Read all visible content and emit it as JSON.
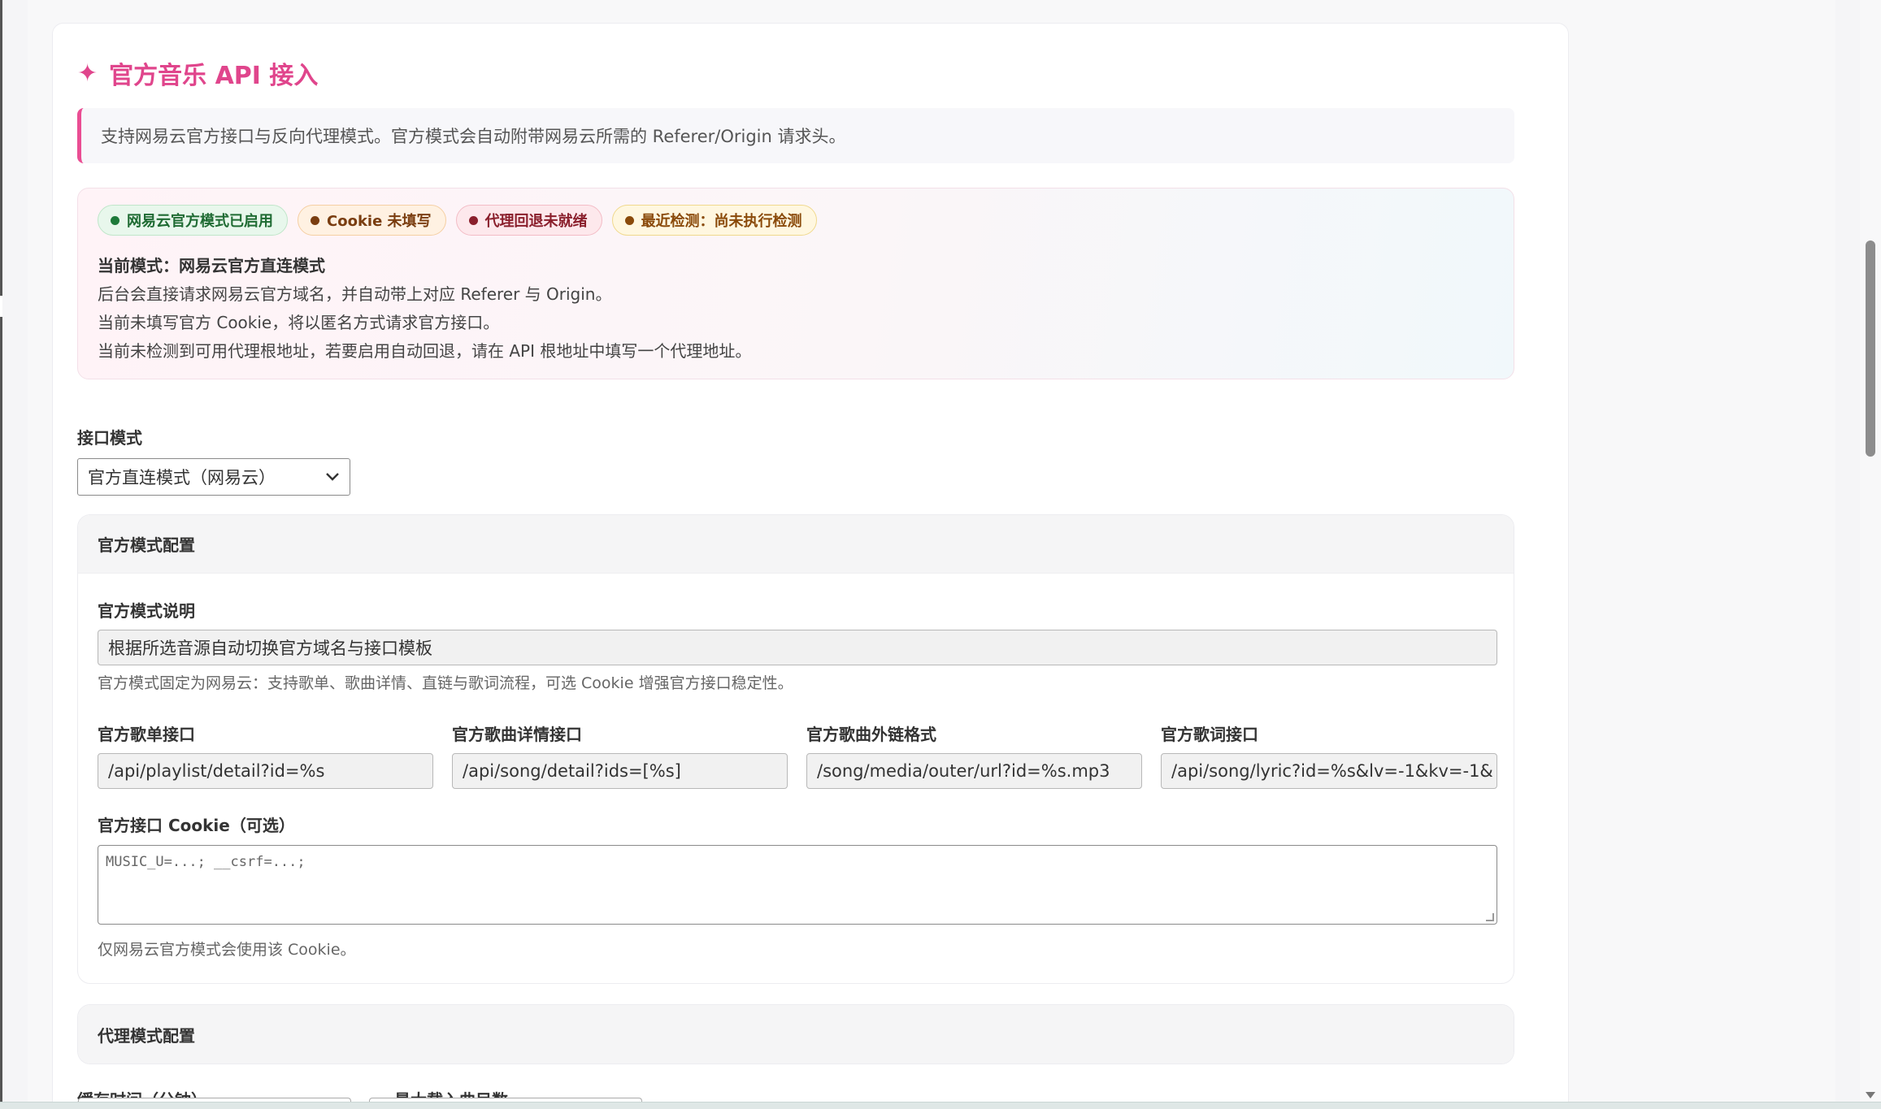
{
  "card": {
    "title": "官方音乐 API 接入",
    "note": "支持网易云官方接口与反向代理模式。官方模式会自动附带网易云所需的 Referer/Origin 请求头。"
  },
  "status": {
    "badges": [
      {
        "label": "网易云官方模式已启用",
        "tone": "green",
        "color": "#1e7a3a"
      },
      {
        "label": "Cookie 未填写",
        "tone": "orange",
        "color": "#7a3d10"
      },
      {
        "label": "代理回退未就绪",
        "tone": "red",
        "color": "#8a1f2c"
      },
      {
        "label": "最近检测：尚未执行检测",
        "tone": "yellow",
        "color": "#8a4a0a"
      }
    ],
    "mode_line": "当前模式：网易云官方直连模式",
    "lines": [
      "后台会直接请求网易云官方域名，并自动带上对应 Referer 与 Origin。",
      "当前未填写官方 Cookie，将以匿名方式请求官方接口。",
      "当前未检测到可用代理根地址，若要启用自动回退，请在 API 根地址中填写一个代理地址。"
    ]
  },
  "interface_mode": {
    "label": "接口模式",
    "selected": "官方直连模式（网易云）"
  },
  "official": {
    "header": "官方模式配置",
    "desc_label": "官方模式说明",
    "desc_value": "根据所选音源自动切换官方域名与接口模板",
    "desc_help": "官方模式固定为网易云：支持歌单、歌曲详情、直链与歌词流程，可选 Cookie 增强官方接口稳定性。",
    "fields": [
      {
        "label": "官方歌单接口",
        "value": "/api/playlist/detail?id=%s"
      },
      {
        "label": "官方歌曲详情接口",
        "value": "/api/song/detail?ids=[%s]"
      },
      {
        "label": "官方歌曲外链格式",
        "value": "/song/media/outer/url?id=%s.mp3"
      },
      {
        "label": "官方歌词接口",
        "value": "/api/song/lyric?id=%s&lv=-1&kv=-1&"
      }
    ],
    "cookie_label": "官方接口 Cookie（可选）",
    "cookie_placeholder": "MUSIC_U=...; __csrf=...;",
    "cookie_help": "仅网易云官方模式会使用该 Cookie。"
  },
  "proxy": {
    "header": "代理模式配置",
    "cache_label": "缓存时间（分钟）",
    "max_label": "最大载入曲目数"
  },
  "colors": {
    "accent": "#e0458c",
    "note_border": "#ea4d93"
  }
}
